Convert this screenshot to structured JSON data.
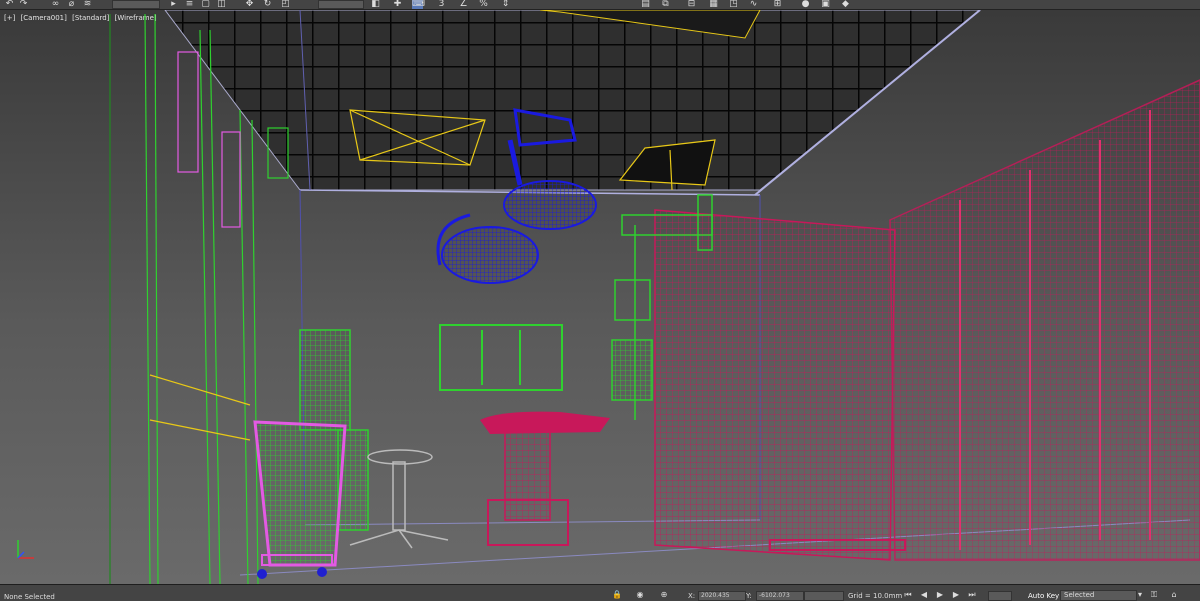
{
  "viewport": {
    "labels": [
      "[+]",
      "[Camera001]",
      "[Standard]",
      "[Wireframe]"
    ]
  },
  "toolbar": {
    "icons": [
      "undo-icon",
      "redo-icon",
      "link-icon",
      "unlink-icon",
      "bind-icon",
      "select-filter-field",
      "select-icon",
      "select-by-name-icon",
      "rect-select-icon",
      "window-crossing-icon",
      "move-icon",
      "rotate-icon",
      "scale-icon",
      "ref-coord-field",
      "pivot-icon",
      "select-manipulate-icon",
      "keyboard-shortcut-icon",
      "snap-toggle-icon",
      "angle-snap-icon",
      "percent-snap-icon",
      "spinner-snap-icon"
    ]
  },
  "status": {
    "selection_text": "None Selected",
    "x_label": "X:",
    "x_value": "2020.435",
    "y_label": "Y:",
    "y_value": "-6102.073",
    "grid_text": "Grid = 10.0mm",
    "autokey_label": "Auto Key",
    "selection_set": "Selected"
  },
  "colors": {
    "wire_green": "#2fd12f",
    "wire_crimson": "#c8185a",
    "wire_blue": "#1a1ae0",
    "wire_yellow": "#e8c817",
    "wire_magenta": "#e35ae3",
    "ceiling_grid": "#050505"
  }
}
